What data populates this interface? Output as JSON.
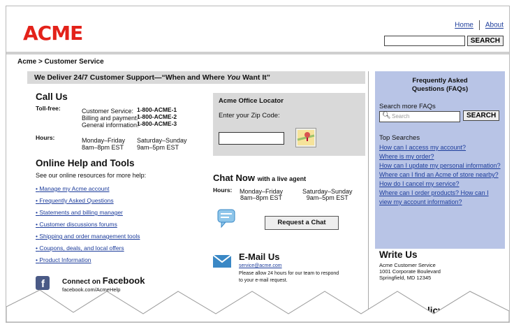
{
  "header": {
    "logo": "ACME",
    "home": "Home",
    "about": "About",
    "search_button": "SEARCH"
  },
  "breadcrumb": "Acme > Customer Service",
  "banner": {
    "prefix": "We Deliver 24/7 Customer Support—“When and Where ",
    "emph": "You",
    "suffix": " Want It”"
  },
  "call_us": {
    "title": "Call Us",
    "tollfree_label": "Toll-free:",
    "rows": [
      {
        "name": "Customer Service:",
        "number": "1-800-ACME-1"
      },
      {
        "name": "Billing and payment:",
        "number": "1-800-ACME-2"
      },
      {
        "name": "General information:",
        "number": "1-800-ACME-3"
      }
    ],
    "hours_label": "Hours:",
    "weekday": "Monday–Friday",
    "weekday_time": "8am–8pm EST",
    "weekend": "Saturday–Sunday",
    "weekend_time": "9am–5pm EST"
  },
  "locator": {
    "title": "Acme Office Locator",
    "prompt": "Enter your Zip Code:"
  },
  "online_help": {
    "title": "Online Help and Tools",
    "intro": "See our online resources for more help:",
    "links": [
      "Manage my Acme account",
      "Frequently Asked Questions",
      "Statements and billing manager",
      "Customer discussions forums",
      "Shipping and order management tools",
      "Coupons, deals, and local offers",
      "Product Information"
    ]
  },
  "chat": {
    "title": "Chat Now",
    "subtitle": "with a live agent",
    "hours_label": "Hours:",
    "weekday": "Monday–Friday",
    "weekday_time": "8am–8pm EST",
    "weekend": "Saturday–Sunday",
    "weekend_time": "9am–5pm EST",
    "button": "Request a Chat"
  },
  "email": {
    "title": "E-Mail Us",
    "address": "service@acme.com",
    "note1": "Please allow 24 hours for our team to respond",
    "note2": "to your e-mail request."
  },
  "facebook": {
    "prefix": "Connect on ",
    "brand": "Facebook",
    "url": "facebook.com/AcmeHelp"
  },
  "faq": {
    "title1": "Frequently Asked",
    "title2": "Questions (FAQs)",
    "search_label": "Search more FAQs",
    "search_placeholder": "Search",
    "search_button": "SEARCH",
    "top_searches": "Top Searches",
    "links": [
      "How can I access my account?",
      "Where is my order?",
      "How can I update my personal information?",
      "Where can I find an Acme of store nearby?",
      "How do I cancel my service?",
      "Where can I order products? How can I view my account information?"
    ]
  },
  "write_us": {
    "title": "Write Us",
    "line1": "Acme Customer Service",
    "line2": "1001 Corporate Boulevard",
    "line3": "Springfield, MD 12345"
  },
  "privacy": {
    "title": "Privacy Policy"
  },
  "colors": {
    "brand": "#e3221a",
    "link": "#1c3c9b",
    "faq_bg": "#b8c4e6",
    "panel": "#d9d9d9"
  }
}
